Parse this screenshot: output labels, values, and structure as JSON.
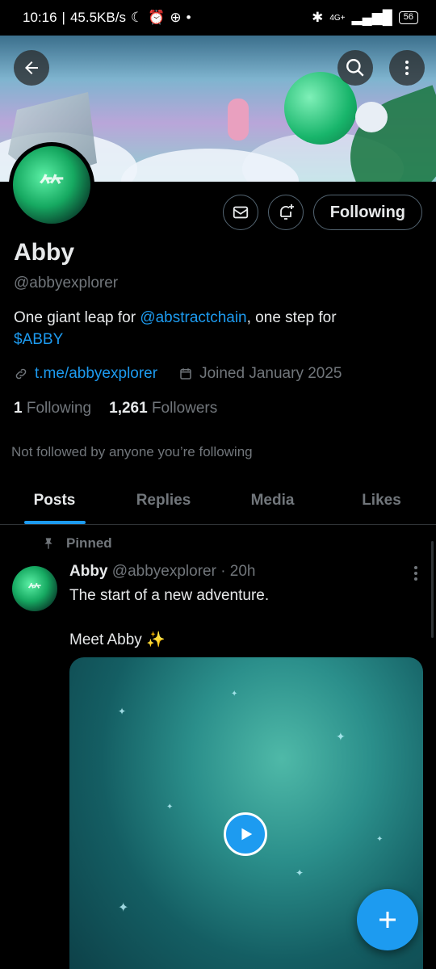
{
  "status_bar": {
    "time": "10:16",
    "net_speed": "45.5KB/s",
    "network": "4G+",
    "battery": "56"
  },
  "profile": {
    "name": "Abby",
    "handle": "@abbyexplorer",
    "bio_prefix": "One giant leap for ",
    "bio_mention": "@abstractchain",
    "bio_middle": ", one step for",
    "bio_cashtag": "$ABBY",
    "website": "t.me/abbyexplorer",
    "joined": "Joined January 2025",
    "following_count": "1",
    "following_label": "Following",
    "followers_count": "1,261",
    "followers_label": "Followers",
    "not_followed_text": "Not followed by anyone you’re following",
    "follow_button_label": "Following"
  },
  "tabs": [
    {
      "label": "Posts",
      "active": true
    },
    {
      "label": "Replies",
      "active": false
    },
    {
      "label": "Media",
      "active": false
    },
    {
      "label": "Likes",
      "active": false
    }
  ],
  "post": {
    "pinned_label": "Pinned",
    "author": "Abby",
    "handle_time": "@abbyexplorer · 20h",
    "text_line1": "The start of a new adventure.",
    "text_line2": "Meet Abby ✨"
  },
  "colors": {
    "accent": "#1d9bf0",
    "background": "#000000",
    "secondary_text": "#71767b"
  },
  "icons": [
    "back-arrow-icon",
    "search-icon",
    "more-vertical-icon",
    "mail-icon",
    "bell-plus-icon",
    "link-icon",
    "calendar-icon",
    "pin-icon",
    "play-icon",
    "plus-icon"
  ]
}
